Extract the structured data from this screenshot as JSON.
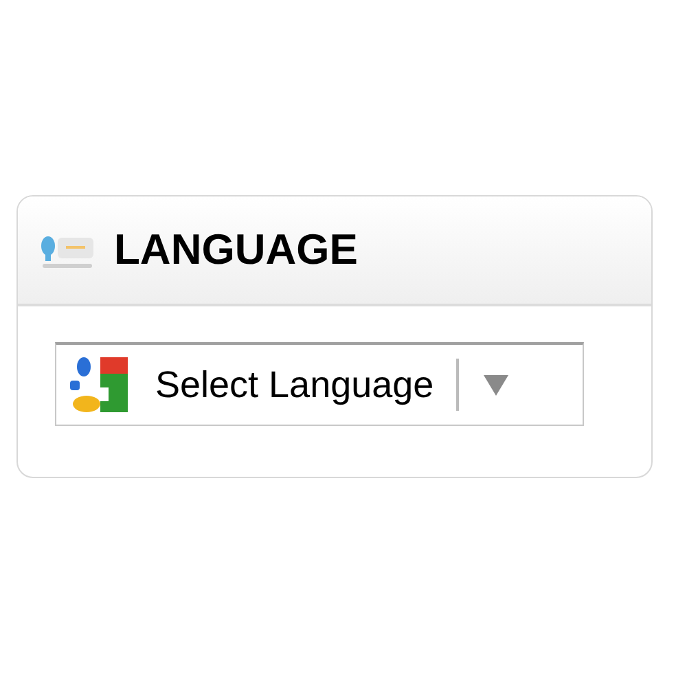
{
  "widget": {
    "title": "LANGUAGE",
    "select": {
      "value": "Select Language"
    }
  }
}
